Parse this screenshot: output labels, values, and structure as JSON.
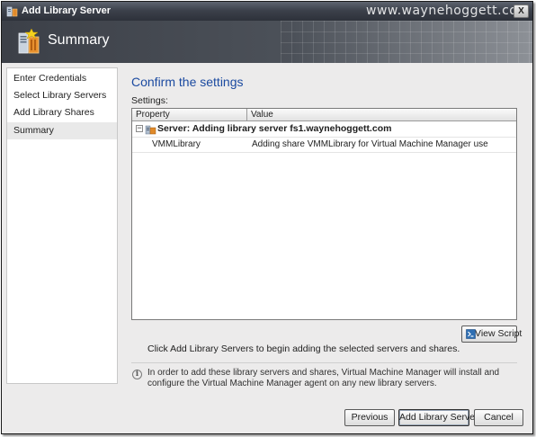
{
  "window": {
    "title": "Add Library Server",
    "watermark": "www.waynehoggett.com",
    "close_glyph": "X"
  },
  "header": {
    "title": "Summary",
    "icon": "library-server-icon"
  },
  "nav": {
    "items": [
      {
        "label": "Enter Credentials",
        "selected": false
      },
      {
        "label": "Select Library Servers",
        "selected": false
      },
      {
        "label": "Add Library Shares",
        "selected": false
      },
      {
        "label": "Summary",
        "selected": true
      }
    ]
  },
  "main": {
    "title": "Confirm the settings",
    "settings_label": "Settings:",
    "table": {
      "columns": [
        "Property",
        "Value"
      ],
      "group": {
        "label": "Server: Adding library server fs1.waynehoggett.com",
        "collapse_glyph": "−"
      },
      "rows": [
        {
          "property": "VMMLibrary",
          "value": "Adding share VMMLibrary for Virtual Machine Manager use"
        }
      ]
    },
    "view_script_label": "View Script",
    "hint": "Click Add Library Servers to begin adding the selected servers and shares.",
    "info_glyph": "i",
    "info_text": "In order to add these library servers and shares, Virtual Machine Manager will install and configure the Virtual Machine Manager agent on any new library servers."
  },
  "footer": {
    "previous_label": "Previous",
    "add_label": "Add Library Servers",
    "cancel_label": "Cancel"
  },
  "colors": {
    "accent_title": "#1b4aa0",
    "titlebar": "#3c414b"
  }
}
